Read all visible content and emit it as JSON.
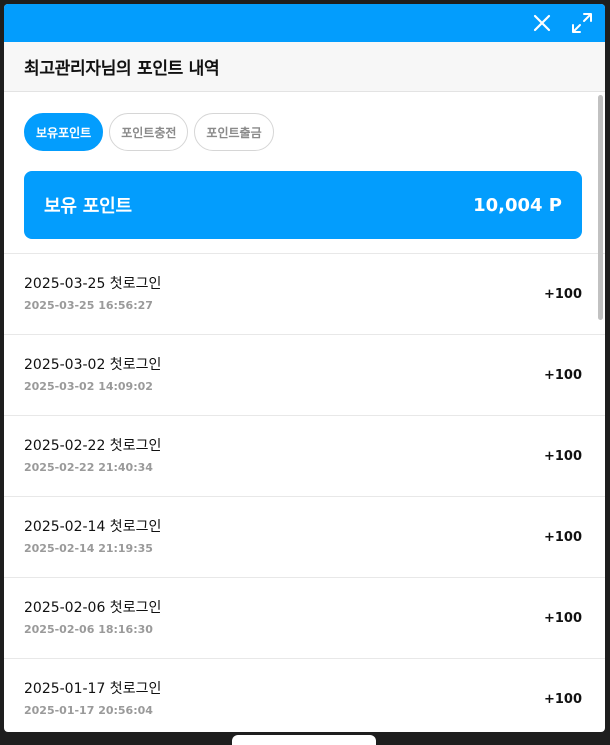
{
  "header": {
    "title": "최고관리자님의 포인트 내역"
  },
  "tabs": [
    {
      "label": "보유포인트",
      "active": true
    },
    {
      "label": "포인트충전",
      "active": false
    },
    {
      "label": "포인트출금",
      "active": false
    }
  ],
  "balance": {
    "label": "보유 포인트",
    "value": "10,004 P"
  },
  "entries": [
    {
      "title": "2025-03-25 첫로그인",
      "datetime": "2025-03-25 16:56:27",
      "amount": "+100"
    },
    {
      "title": "2025-03-02 첫로그인",
      "datetime": "2025-03-02 14:09:02",
      "amount": "+100"
    },
    {
      "title": "2025-02-22 첫로그인",
      "datetime": "2025-02-22 21:40:34",
      "amount": "+100"
    },
    {
      "title": "2025-02-14 첫로그인",
      "datetime": "2025-02-14 21:19:35",
      "amount": "+100"
    },
    {
      "title": "2025-02-06 첫로그인",
      "datetime": "2025-02-06 18:16:30",
      "amount": "+100"
    },
    {
      "title": "2025-01-17 첫로그인",
      "datetime": "2025-01-17 20:56:04",
      "amount": "+100"
    }
  ],
  "colors": {
    "accent": "#039dfd",
    "text": "#111111",
    "muted": "#9a9a9a"
  },
  "icons": {
    "close": "close-icon",
    "expand": "expand-icon"
  }
}
